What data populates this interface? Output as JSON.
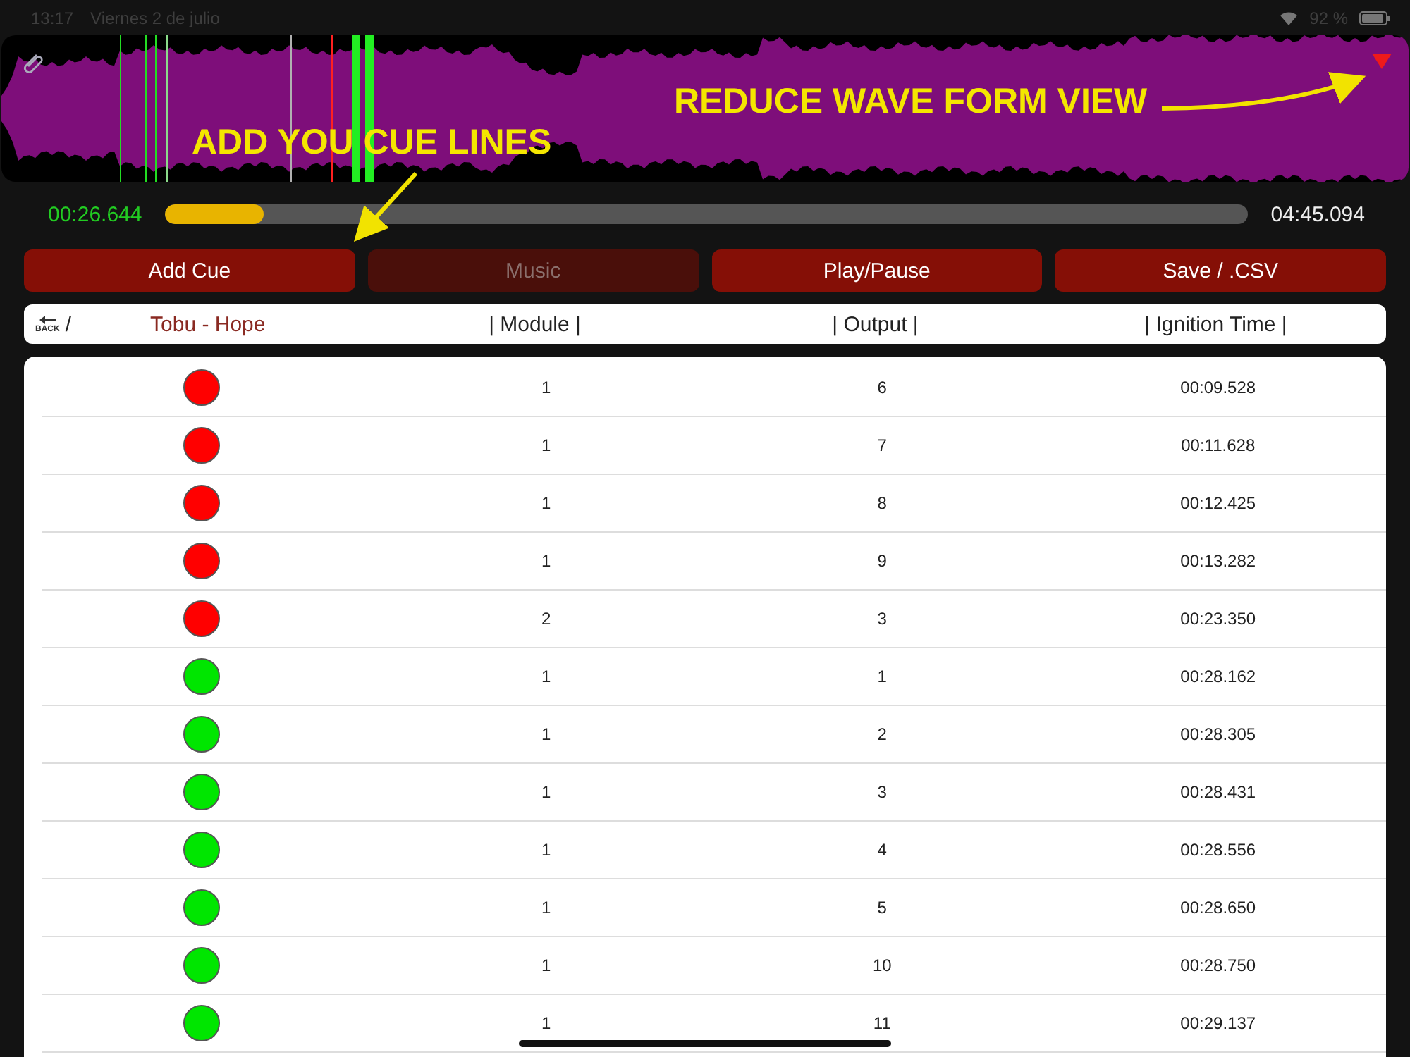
{
  "status_bar": {
    "time": "13:17",
    "date": "Viernes 2 de julio",
    "battery": "92 %"
  },
  "waveform": {
    "annotations": [
      {
        "text": "ADD YOU CUE LINES",
        "kind": "cue"
      },
      {
        "text": "REDUCE WAVE FORM VIEW",
        "kind": "reduce"
      }
    ]
  },
  "playback": {
    "elapsed": "00:26.644",
    "level": 0.092,
    "total": "04:45.094"
  },
  "buttons": [
    {
      "label": "Add Cue",
      "disabled": false
    },
    {
      "label": "Music",
      "disabled": true
    },
    {
      "label": "Play/Pause",
      "disabled": false
    },
    {
      "label": "Save / .CSV",
      "disabled": false
    }
  ],
  "header": {
    "back": "BACK",
    "separator": "/",
    "song": "Tobu - Hope",
    "columns": [
      "| Module |",
      "| Output |",
      "| Ignition Time |"
    ]
  },
  "rows": [
    {
      "color": "#ff0000",
      "module": "1",
      "output": "6",
      "time": "00:09.528"
    },
    {
      "color": "#ff0000",
      "module": "1",
      "output": "7",
      "time": "00:11.628"
    },
    {
      "color": "#ff0000",
      "module": "1",
      "output": "8",
      "time": "00:12.425"
    },
    {
      "color": "#ff0000",
      "module": "1",
      "output": "9",
      "time": "00:13.282"
    },
    {
      "color": "#ff0000",
      "module": "2",
      "output": "3",
      "time": "00:23.350"
    },
    {
      "color": "#00e600",
      "module": "1",
      "output": "1",
      "time": "00:28.162"
    },
    {
      "color": "#00e600",
      "module": "1",
      "output": "2",
      "time": "00:28.305"
    },
    {
      "color": "#00e600",
      "module": "1",
      "output": "3",
      "time": "00:28.431"
    },
    {
      "color": "#00e600",
      "module": "1",
      "output": "4",
      "time": "00:28.556"
    },
    {
      "color": "#00e600",
      "module": "1",
      "output": "5",
      "time": "00:28.650"
    },
    {
      "color": "#00e600",
      "module": "1",
      "output": "10",
      "time": "00:28.750"
    },
    {
      "color": "#00e600",
      "module": "1",
      "output": "11",
      "time": "00:29.137"
    }
  ]
}
